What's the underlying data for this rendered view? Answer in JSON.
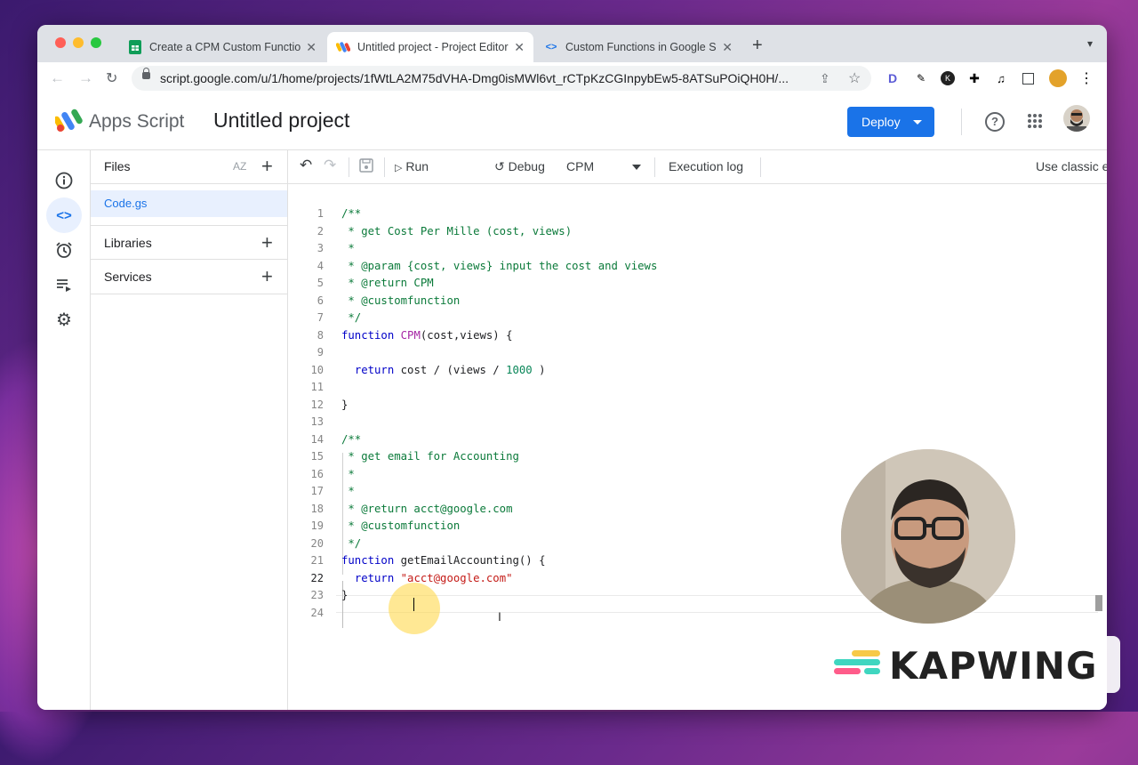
{
  "colors": {
    "accent": "#1a73e8",
    "deploy": "#1a73e8",
    "comment": "#0b7a3a",
    "keyword": "#0000c8",
    "function_name": "#a626a4",
    "number": "#098658",
    "string": "#c41a16"
  },
  "browser": {
    "tabs": [
      {
        "title": "Create a CPM Custom Function",
        "favicon": "sheets-icon",
        "active": false
      },
      {
        "title": "Untitled project - Project Editor",
        "favicon": "apps-script-icon",
        "active": true
      },
      {
        "title": "Custom Functions in Google Sheets",
        "favicon": "code-icon",
        "active": false
      }
    ],
    "url": "script.google.com/u/1/home/projects/1fWtLA2M75dVHA-Dmg0isMWl6vt_rCTpKzCGInpybEw5-8ATSuPOiQH0H/..."
  },
  "app": {
    "name": "Apps Script",
    "project_title": "Untitled project",
    "deploy_label": "Deploy"
  },
  "sidebar": {
    "files_title": "Files",
    "sort_label": "AZ",
    "active_file": "Code.gs",
    "sections": [
      "Libraries",
      "Services"
    ]
  },
  "editor_toolbar": {
    "run_label": "Run",
    "debug_label": "Debug",
    "function_selected": "CPM",
    "execution_log_label": "Execution log",
    "classic_editor_label": "Use classic editor"
  },
  "code": {
    "current_line": 22,
    "lines": [
      [
        {
          "t": "/**",
          "c": "cm"
        }
      ],
      [
        {
          "t": " * get Cost Per Mille (cost, views)",
          "c": "cm"
        }
      ],
      [
        {
          "t": " *",
          "c": "cm"
        }
      ],
      [
        {
          "t": " * @param {cost, views} input the cost and views",
          "c": "cm"
        }
      ],
      [
        {
          "t": " * @return CPM",
          "c": "cm"
        }
      ],
      [
        {
          "t": " * @customfunction",
          "c": "cm"
        }
      ],
      [
        {
          "t": " */",
          "c": "cm"
        }
      ],
      [
        {
          "t": "function ",
          "c": "kw"
        },
        {
          "t": "CPM",
          "c": "fnn"
        },
        {
          "t": "(cost,views) {",
          "c": ""
        }
      ],
      [
        {
          "t": "",
          "c": ""
        }
      ],
      [
        {
          "t": "  ",
          "c": ""
        },
        {
          "t": "return",
          "c": "kw"
        },
        {
          "t": " cost / (views / ",
          "c": ""
        },
        {
          "t": "1000",
          "c": "num"
        },
        {
          "t": " )",
          "c": ""
        }
      ],
      [
        {
          "t": "",
          "c": ""
        }
      ],
      [
        {
          "t": "}",
          "c": ""
        }
      ],
      [
        {
          "t": "",
          "c": ""
        }
      ],
      [
        {
          "t": "/**",
          "c": "cm"
        }
      ],
      [
        {
          "t": " * get email for Accounting",
          "c": "cm"
        }
      ],
      [
        {
          "t": " *",
          "c": "cm"
        }
      ],
      [
        {
          "t": " *",
          "c": "cm"
        }
      ],
      [
        {
          "t": " * @return acct@google.com",
          "c": "cm"
        }
      ],
      [
        {
          "t": " * @customfunction",
          "c": "cm"
        }
      ],
      [
        {
          "t": " */",
          "c": "cm"
        }
      ],
      [
        {
          "t": "function ",
          "c": "kw"
        },
        {
          "t": "getEmailAccounting",
          "c": ""
        },
        {
          "t": "() {",
          "c": ""
        }
      ],
      [
        {
          "t": "  ",
          "c": ""
        },
        {
          "t": "return",
          "c": "kw"
        },
        {
          "t": " ",
          "c": ""
        },
        {
          "t": "\"acct@google.com\"",
          "c": "str"
        }
      ],
      [
        {
          "t": "}",
          "c": ""
        }
      ],
      [
        {
          "t": "",
          "c": ""
        }
      ]
    ]
  },
  "watermark": {
    "text": "KAPWING"
  }
}
